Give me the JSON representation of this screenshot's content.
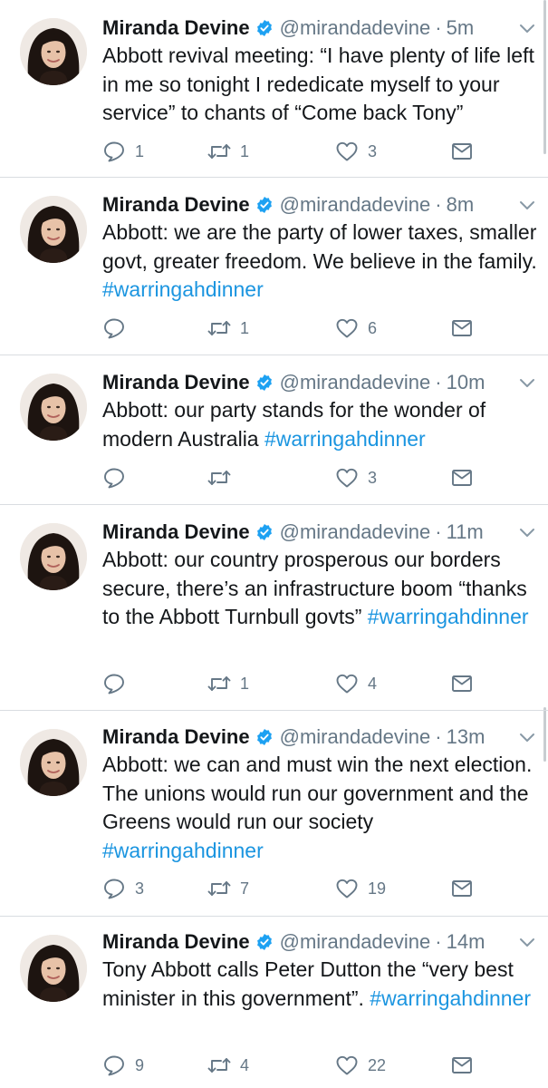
{
  "colors": {
    "name": "#14171a",
    "secondary": "#657786",
    "link": "#1b95e0",
    "verified": "#1da1f2",
    "divider": "#d9dde1"
  },
  "icons": {
    "reply": "reply-icon",
    "retweet": "retweet-icon",
    "like": "heart-icon",
    "dm": "envelope-icon",
    "verified": "verified-badge-icon",
    "more": "chevron-down-icon"
  },
  "tweets": [
    {
      "name": "Miranda Devine",
      "handle": "@mirandadevine",
      "sep": "·",
      "time": "5m",
      "text": "Abbott revival meeting: “I have plenty of life left in me so tonight I rededicate myself to your service” to chants of “Come back Tony”",
      "hashtag": "",
      "replies": "1",
      "retweets": "1",
      "likes": "3"
    },
    {
      "name": "Miranda Devine",
      "handle": "@mirandadevine",
      "sep": "·",
      "time": "8m",
      "text": "Abbott: we are the party of lower taxes, smaller govt, greater freedom. We believe in the family. ",
      "hashtag": "#warringahdinner",
      "replies": "",
      "retweets": "1",
      "likes": "6"
    },
    {
      "name": "Miranda Devine",
      "handle": "@mirandadevine",
      "sep": "·",
      "time": "10m",
      "text": "Abbott: our party stands for the wonder of modern Australia ",
      "hashtag": "#warringahdinner",
      "replies": "",
      "retweets": "",
      "likes": "3"
    },
    {
      "name": "Miranda Devine",
      "handle": "@mirandadevine",
      "sep": "·",
      "time": "11m",
      "text": "Abbott: our country prosperous our borders secure, there’s an infrastructure boom “thanks to the Abbott Turnbull govts” ",
      "hashtag": "#warringahdinner",
      "replies": "",
      "retweets": "1",
      "likes": "4"
    },
    {
      "name": "Miranda Devine",
      "handle": "@mirandadevine",
      "sep": "·",
      "time": "13m",
      "text": "Abbott: we can and must win the next election. The unions would run our government and the Greens would run our society ",
      "hashtag": "#warringahdinner",
      "replies": "3",
      "retweets": "7",
      "likes": "19"
    },
    {
      "name": "Miranda Devine",
      "handle": "@mirandadevine",
      "sep": "·",
      "time": "14m",
      "text": "Tony Abbott calls Peter Dutton the “very best minister in this government”. ",
      "hashtag": "#warringahdinner",
      "replies": "9",
      "retweets": "4",
      "likes": "22"
    }
  ]
}
